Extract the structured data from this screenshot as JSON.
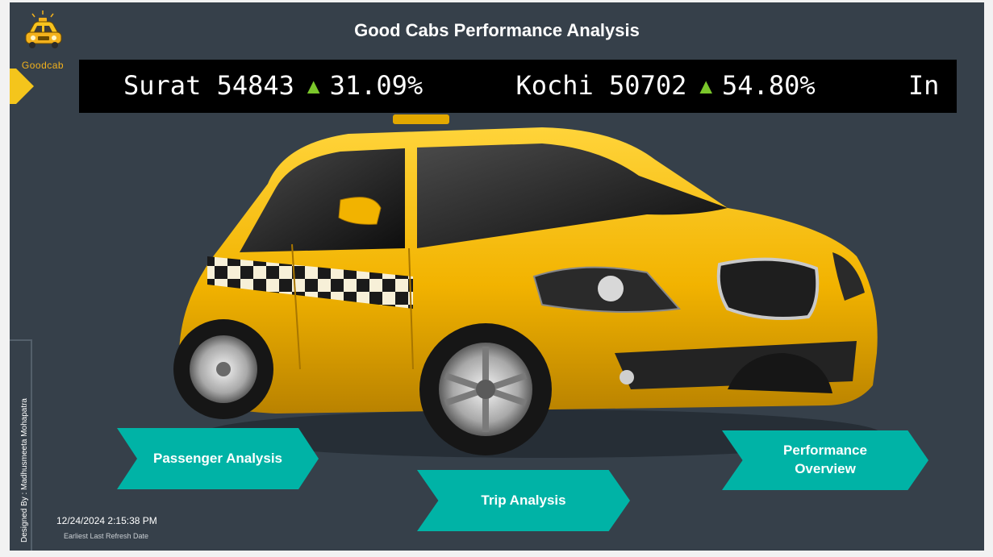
{
  "logo": {
    "text": "Goodcab",
    "icon": "taxi-car-icon"
  },
  "header": {
    "title": "Good Cabs Performance Analysis"
  },
  "ticker": {
    "items": [
      {
        "city": "Surat",
        "value": "54843",
        "change": "31.09%"
      },
      {
        "city": "Kochi",
        "value": "50702",
        "change": "54.80%"
      },
      {
        "city": "In",
        "value": "",
        "change": ""
      }
    ],
    "up_arrow": "▲"
  },
  "hero": {
    "image": "yellow-taxi-car-image"
  },
  "nav": {
    "passenger": "Passenger Analysis",
    "trip": "Trip Analysis",
    "performance": "Performance Overview"
  },
  "footer": {
    "designer": "Designed By : Madhusmeeta Mohapatra",
    "refresh_date": "12/24/2024 2:15:38 PM",
    "refresh_label": "Earliest Last Refresh Date"
  },
  "colors": {
    "background": "#36404a",
    "accent": "#00b3a6",
    "taxi_yellow": "#f4b21c",
    "ticker_up": "#7bc72b"
  }
}
